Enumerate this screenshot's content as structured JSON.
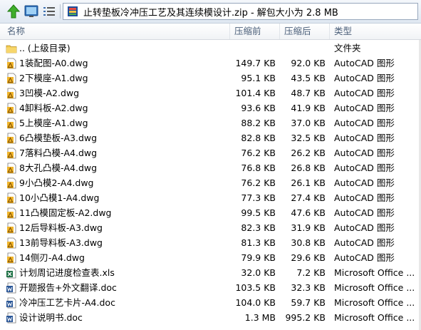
{
  "toolbar": {
    "up_icon": "up-arrow-icon",
    "view_icon": "view-mode-icon",
    "list_icon": "details-list-icon",
    "archive_icon": "zip-archive-icon",
    "path_text": "止转垫板冷冲压工艺及其连续模设计.zip - 解包大小为 2.8 MB"
  },
  "columns": {
    "name": "名称",
    "size": "压缩前",
    "packed": "压缩后",
    "type": "类型"
  },
  "files": [
    {
      "name": ".. (上级目录)",
      "size": "",
      "packed": "",
      "type": "文件夹",
      "icon": "folder-icon"
    },
    {
      "name": "1装配图-A0.dwg",
      "size": "149.7 KB",
      "packed": "92.0 KB",
      "type": "AutoCAD 图形",
      "icon": "dwg-file-icon"
    },
    {
      "name": "2下模座-A1.dwg",
      "size": "95.1 KB",
      "packed": "43.5 KB",
      "type": "AutoCAD 图形",
      "icon": "dwg-file-icon"
    },
    {
      "name": "3凹模-A2.dwg",
      "size": "101.4 KB",
      "packed": "48.7 KB",
      "type": "AutoCAD 图形",
      "icon": "dwg-file-icon"
    },
    {
      "name": "4卸料板-A2.dwg",
      "size": "93.6 KB",
      "packed": "41.9 KB",
      "type": "AutoCAD 图形",
      "icon": "dwg-file-icon"
    },
    {
      "name": "5上模座-A1.dwg",
      "size": "88.2 KB",
      "packed": "37.0 KB",
      "type": "AutoCAD 图形",
      "icon": "dwg-file-icon"
    },
    {
      "name": "6凸模垫板-A3.dwg",
      "size": "82.8 KB",
      "packed": "32.5 KB",
      "type": "AutoCAD 图形",
      "icon": "dwg-file-icon"
    },
    {
      "name": "7落料凸模-A4.dwg",
      "size": "76.2 KB",
      "packed": "26.2 KB",
      "type": "AutoCAD 图形",
      "icon": "dwg-file-icon"
    },
    {
      "name": "8大孔凸模-A4.dwg",
      "size": "76.8 KB",
      "packed": "26.8 KB",
      "type": "AutoCAD 图形",
      "icon": "dwg-file-icon"
    },
    {
      "name": "9小凸模2-A4.dwg",
      "size": "76.2 KB",
      "packed": "26.1 KB",
      "type": "AutoCAD 图形",
      "icon": "dwg-file-icon"
    },
    {
      "name": "10小凸模1-A4.dwg",
      "size": "77.3 KB",
      "packed": "27.4 KB",
      "type": "AutoCAD 图形",
      "icon": "dwg-file-icon"
    },
    {
      "name": "11凸模固定板-A2.dwg",
      "size": "99.5 KB",
      "packed": "47.6 KB",
      "type": "AutoCAD 图形",
      "icon": "dwg-file-icon"
    },
    {
      "name": "12后导料板-A3.dwg",
      "size": "82.3 KB",
      "packed": "31.9 KB",
      "type": "AutoCAD 图形",
      "icon": "dwg-file-icon"
    },
    {
      "name": "13前导料板-A3.dwg",
      "size": "81.3 KB",
      "packed": "30.8 KB",
      "type": "AutoCAD 图形",
      "icon": "dwg-file-icon"
    },
    {
      "name": "14侧刃-A4.dwg",
      "size": "79.9 KB",
      "packed": "29.6 KB",
      "type": "AutoCAD 图形",
      "icon": "dwg-file-icon"
    },
    {
      "name": "计划周记进度检查表.xls",
      "size": "32.0 KB",
      "packed": "7.2 KB",
      "type": "Microsoft Office ...",
      "icon": "xls-file-icon"
    },
    {
      "name": "开题报告+外文翻译.doc",
      "size": "103.5 KB",
      "packed": "32.3 KB",
      "type": "Microsoft Office ...",
      "icon": "doc-file-icon"
    },
    {
      "name": "冷冲压工艺卡片-A4.doc",
      "size": "104.0 KB",
      "packed": "59.7 KB",
      "type": "Microsoft Office ...",
      "icon": "doc-file-icon"
    },
    {
      "name": "设计说明书.doc",
      "size": "1.3 MB",
      "packed": "995.2 KB",
      "type": "Microsoft Office ...",
      "icon": "doc-file-icon"
    }
  ]
}
